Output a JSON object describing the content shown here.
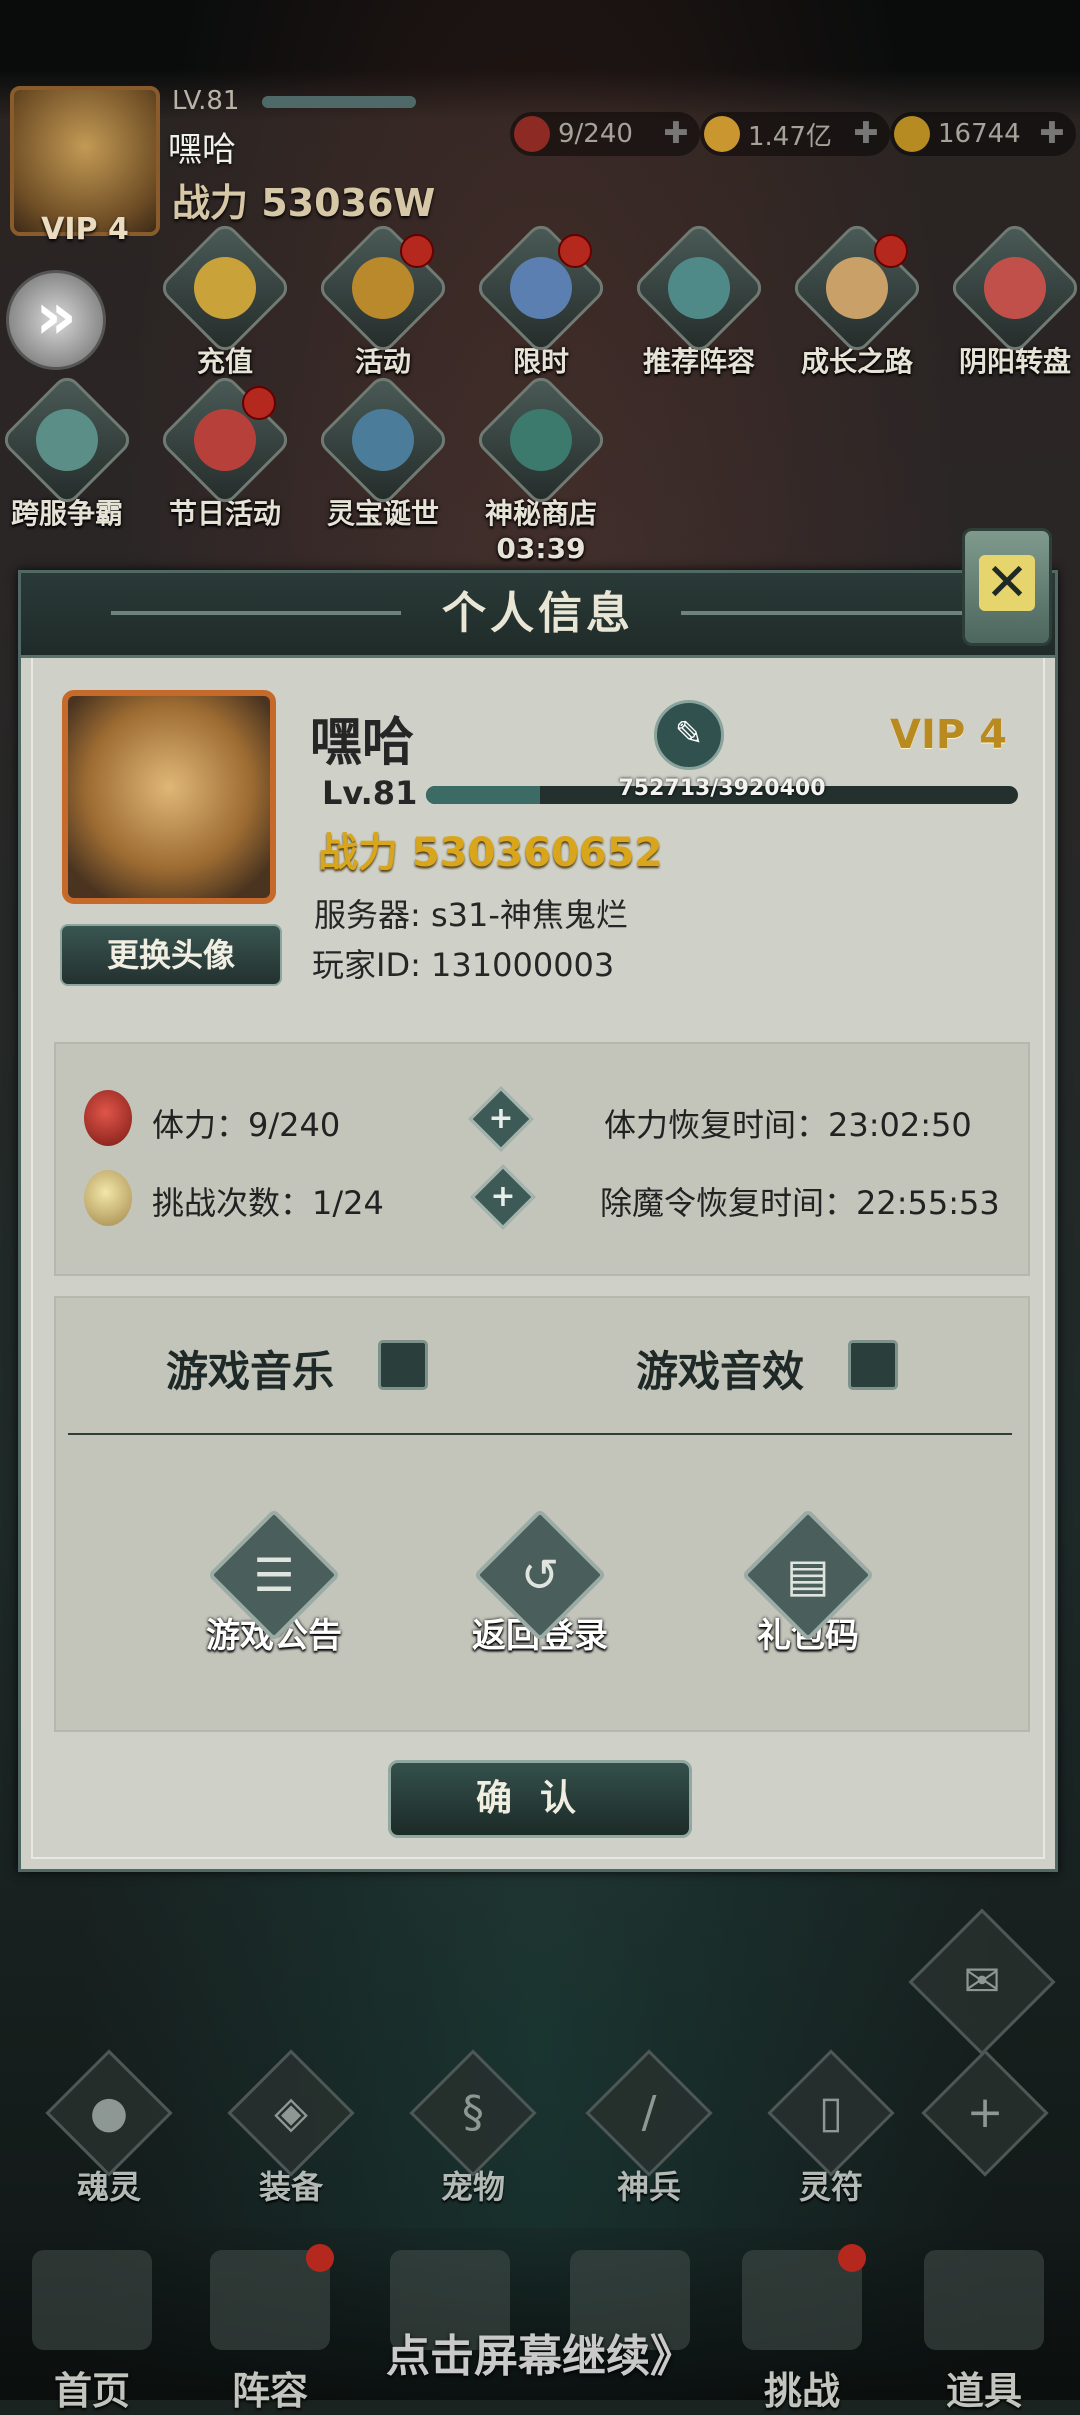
{
  "top": {
    "level": "LV.81",
    "player_name": "嘿哈",
    "power": "战力 53036W",
    "vip": "VIP 4",
    "resources": [
      {
        "icon": "stamina-icon",
        "value": "9/240"
      },
      {
        "icon": "coin-icon",
        "value": "1.47亿"
      },
      {
        "icon": "ingot-icon",
        "value": "16744"
      }
    ],
    "menu_row1": [
      "充值",
      "活动",
      "限时",
      "推荐阵容",
      "成长之路",
      "阴阳转盘"
    ],
    "menu_row2": [
      "跨服争霸",
      "节日活动",
      "灵宝诞世",
      "神秘商店"
    ],
    "shop_timer": "03:39"
  },
  "dialog": {
    "title": "个人信息",
    "name": "嘿哈",
    "vip": "VIP 4",
    "level": "Lv.81",
    "exp": "752713/3920400",
    "exp_fraction": 0.192,
    "power": "战力 530360652",
    "server": "服务器: s31-神焦鬼烂",
    "player_id": "玩家ID: 131000003",
    "change_avatar": "更换头像",
    "stamina": "体力：9/240",
    "stamina_recover": "体力恢复时间：23:02:50",
    "challenges": "挑战次数：1/24",
    "token_recover": "除魔令恢复时间：22:55:53",
    "music": "游戏音乐",
    "sound": "游戏音效",
    "actions": [
      "游戏公告",
      "返回登录",
      "礼包码"
    ],
    "confirm": "确认"
  },
  "bottom": {
    "nav": [
      "魂灵",
      "装备",
      "宠物",
      "神兵",
      "灵符"
    ],
    "tabs": [
      "首页",
      "阵容",
      "",
      "",
      "挑战",
      "道具"
    ],
    "continue": "点击屏幕继续》"
  }
}
